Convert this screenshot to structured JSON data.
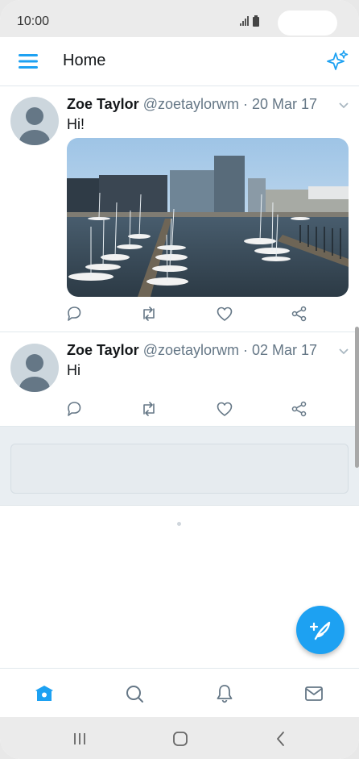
{
  "status_bar": {
    "time": "10:00"
  },
  "app_bar": {
    "title": "Home"
  },
  "tweets": [
    {
      "name": "Zoe Taylor",
      "handle": "@zoetaylorwm",
      "date": "20 Mar 17",
      "text": "Hi!",
      "has_media": true
    },
    {
      "name": "Zoe Taylor",
      "handle": "@zoetaylorwm",
      "date": "02 Mar 17",
      "text": "Hi",
      "has_media": false
    }
  ],
  "separator": " · ",
  "colors": {
    "accent": "#1da1f2",
    "text": "#14171a",
    "secondary": "#657786",
    "divider": "#e1e8ed"
  },
  "icons": {
    "app_bar": [
      "menu-icon",
      "sparkle-icon"
    ],
    "tweet_actions": [
      "reply-icon",
      "retweet-icon",
      "like-icon",
      "share-icon"
    ],
    "tabs": [
      "home-icon",
      "search-icon",
      "notifications-icon",
      "messages-icon"
    ],
    "system_nav": [
      "recent-apps-icon",
      "home-nav-icon",
      "back-icon"
    ]
  }
}
